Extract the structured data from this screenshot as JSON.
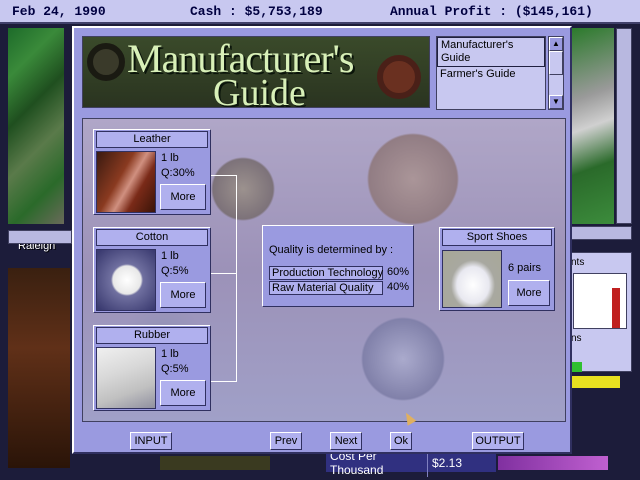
{
  "status_bar": {
    "date": "Feb 24, 1990",
    "cash": "Cash : $5,753,189",
    "profit": "Annual Profit : ($145,161)"
  },
  "background": {
    "city_label": "Raleigh",
    "fragment_1": "nts",
    "fragment_2": "ns",
    "cost_label": "Cost Per Thousand",
    "cost_value": "$2.13"
  },
  "dialog": {
    "banner_line1": "Manufacturer's",
    "banner_line2": "Guide",
    "guides": [
      {
        "label": "Manufacturer's Guide",
        "selected": true
      },
      {
        "label": "Farmer's Guide",
        "selected": false
      }
    ],
    "materials": [
      {
        "name": "Leather",
        "qty": "1 lb",
        "quality": "Q:30%",
        "more": "More"
      },
      {
        "name": "Cotton",
        "qty": "1 lb",
        "quality": "Q:5%",
        "more": "More"
      },
      {
        "name": "Rubber",
        "qty": "1 lb",
        "quality": "Q:5%",
        "more": "More"
      }
    ],
    "quality": {
      "heading": "Quality is determined by :",
      "factors": [
        {
          "name": "Production Technology",
          "pct": "60%"
        },
        {
          "name": "Raw Material Quality",
          "pct": "40%"
        }
      ]
    },
    "product": {
      "name": "Sport Shoes",
      "qty": "6 pairs",
      "more": "More"
    },
    "buttons": {
      "input": "INPUT",
      "prev": "Prev",
      "next": "Next",
      "ok": "Ok",
      "output": "OUTPUT"
    }
  }
}
